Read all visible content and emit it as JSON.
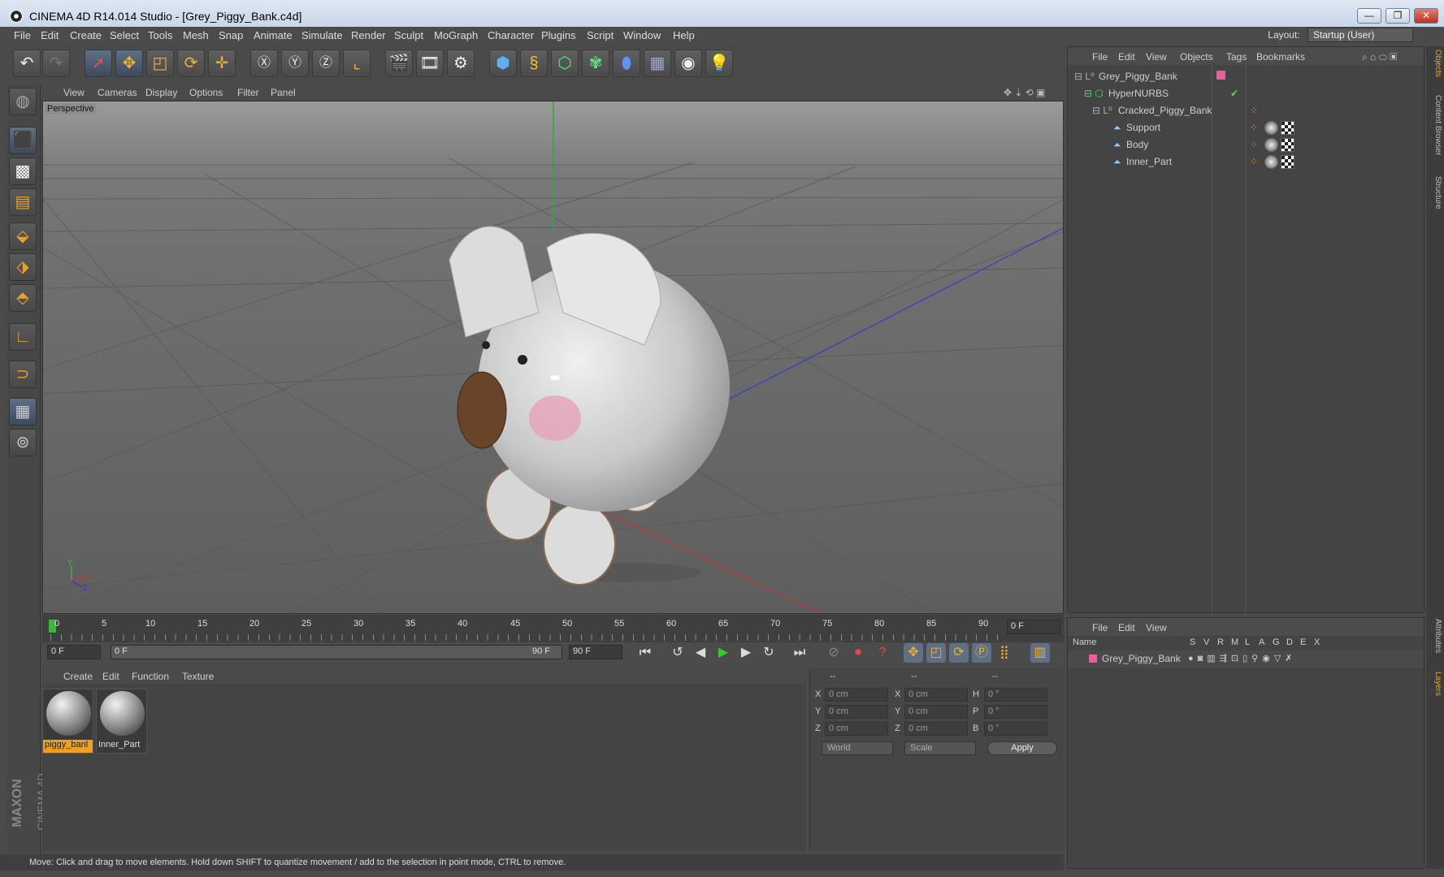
{
  "window": {
    "title": "CINEMA 4D R14.014 Studio - [Grey_Piggy_Bank.c4d]"
  },
  "menubar": {
    "items": [
      "File",
      "Edit",
      "Create",
      "Select",
      "Tools",
      "Mesh",
      "Snap",
      "Animate",
      "Simulate",
      "Render",
      "Sculpt",
      "MoGraph",
      "Character",
      "Plugins",
      "Script",
      "Window",
      "Help"
    ],
    "layout_label": "Layout:",
    "layout_value": "Startup (User)"
  },
  "viewport": {
    "menu": [
      "View",
      "Cameras",
      "Display",
      "Options",
      "Filter",
      "Panel"
    ],
    "label": "Perspective",
    "axis_y": "Y",
    "axis_x": "X",
    "axis_z": "Z"
  },
  "timeline": {
    "ticks": [
      "0",
      "5",
      "10",
      "15",
      "20",
      "25",
      "30",
      "35",
      "40",
      "45",
      "50",
      "55",
      "60",
      "65",
      "70",
      "75",
      "80",
      "85",
      "90"
    ],
    "current_frame": "0 F",
    "start_frame": "0 F",
    "range_start": "0 F",
    "range_end": "90 F",
    "end_frame": "90 F"
  },
  "materials": {
    "menu": [
      "Create",
      "Edit",
      "Function",
      "Texture"
    ],
    "items": [
      {
        "name": "piggy_banl",
        "selected": true
      },
      {
        "name": "Inner_Part",
        "selected": false
      }
    ]
  },
  "coords": {
    "headers": [
      "--",
      "--",
      "--"
    ],
    "rows": [
      {
        "a": "X",
        "av": "0 cm",
        "b": "X",
        "bv": "0 cm",
        "c": "H",
        "cv": "0 °"
      },
      {
        "a": "Y",
        "av": "0 cm",
        "b": "Y",
        "bv": "0 cm",
        "c": "P",
        "cv": "0 °"
      },
      {
        "a": "Z",
        "av": "0 cm",
        "b": "Z",
        "bv": "0 cm",
        "c": "B",
        "cv": "0 °"
      }
    ],
    "mode": "World",
    "scale": "Scale",
    "apply": "Apply"
  },
  "objects": {
    "menu": [
      "File",
      "Edit",
      "View",
      "Objects",
      "Tags",
      "Bookmarks"
    ],
    "tree": [
      "Grey_Piggy_Bank",
      "HyperNURBS",
      "Cracked_Piggy_Bank",
      "Support",
      "Body",
      "Inner_Part"
    ]
  },
  "layers": {
    "menu": [
      "File",
      "Edit",
      "View"
    ],
    "columns": [
      "Name",
      "S",
      "V",
      "R",
      "M",
      "L",
      "A",
      "G",
      "D",
      "E",
      "X"
    ],
    "rows": [
      {
        "name": "Grey_Piggy_Bank"
      }
    ]
  },
  "side_tabs": [
    "Objects",
    "Content Browser",
    "Structure",
    "Attributes",
    "Layers"
  ],
  "status": "Move: Click and drag to move elements. Hold down SHIFT to quantize movement / add to the selection in point mode, CTRL to remove.",
  "brand": {
    "line1": "MAXON",
    "line2": "CINEMA 4D"
  },
  "colors": {
    "accent": "#f0a020",
    "layer_color": "#e8609a",
    "selection": "#5e6f86"
  }
}
